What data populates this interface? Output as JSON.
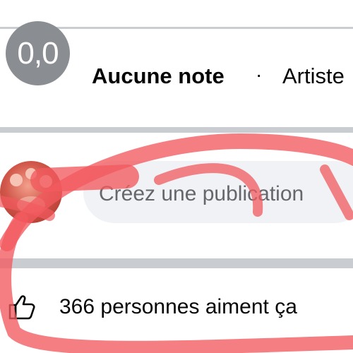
{
  "rating": {
    "score": "0,0",
    "label": "Aucune note",
    "separator": "·",
    "category": "Artiste"
  },
  "composer": {
    "placeholder": "Créez une publication"
  },
  "likes": {
    "text": "366 personnes aiment ça",
    "icon": "thumbs-up-icon"
  },
  "colors": {
    "rating_badge": "#8a8d91",
    "divider": "#c9ccd1",
    "composer_bg": "#f0f2f5",
    "placeholder_text": "#65676b",
    "annotation": "#f25a5f"
  }
}
